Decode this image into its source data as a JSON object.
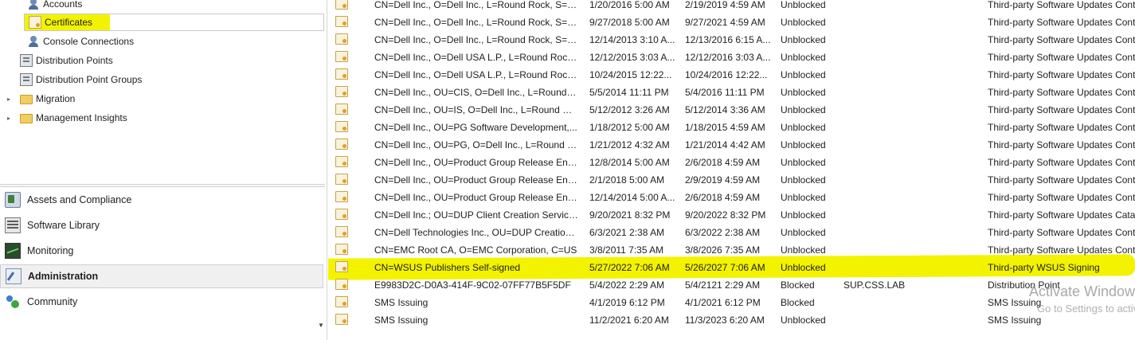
{
  "nav": {
    "tree": [
      {
        "label": "Accounts",
        "icon": "user-icon"
      },
      {
        "label": "Certificates",
        "icon": "certificate-icon"
      },
      {
        "label": "Console Connections",
        "icon": "user-icon"
      },
      {
        "label": "Distribution Points",
        "icon": "distribution-point-icon"
      },
      {
        "label": "Distribution Point Groups",
        "icon": "distribution-point-icon"
      },
      {
        "label": "Migration",
        "icon": "folder-icon"
      },
      {
        "label": "Management Insights",
        "icon": "folder-icon"
      }
    ],
    "workspaces": [
      {
        "label": "Assets and Compliance",
        "icon": "assets-icon"
      },
      {
        "label": "Software Library",
        "icon": "library-icon"
      },
      {
        "label": "Monitoring",
        "icon": "monitor-icon"
      },
      {
        "label": "Administration",
        "icon": "admin-icon"
      },
      {
        "label": "Community",
        "icon": "community-icon"
      }
    ]
  },
  "certificates": [
    {
      "subject": "CN=Dell Inc., O=Dell Inc., L=Round Rock, S=Te...",
      "valid_from": "1/20/2016 5:00 AM",
      "expires": "2/19/2019 4:59 AM",
      "status": "Unblocked",
      "site": "",
      "type": "Third-party Software Updates Cont"
    },
    {
      "subject": "CN=Dell Inc., O=Dell Inc., L=Round Rock, S=Te...",
      "valid_from": "9/27/2018 5:00 AM",
      "expires": "9/27/2021 4:59 AM",
      "status": "Unblocked",
      "site": "",
      "type": "Third-party Software Updates Cont"
    },
    {
      "subject": "CN=Dell Inc., O=Dell Inc., L=Round Rock, S=Te...",
      "valid_from": "12/14/2013 3:10 A...",
      "expires": "12/13/2016 6:15 A...",
      "status": "Unblocked",
      "site": "",
      "type": "Third-party Software Updates Cont"
    },
    {
      "subject": "CN=Dell Inc., O=Dell USA L.P., L=Round Rock,...",
      "valid_from": "12/12/2015 3:03 A...",
      "expires": "12/12/2016 3:03 A...",
      "status": "Unblocked",
      "site": "",
      "type": "Third-party Software Updates Cont"
    },
    {
      "subject": "CN=Dell Inc., O=Dell USA L.P., L=Round Rock,...",
      "valid_from": "10/24/2015 12:22...",
      "expires": "10/24/2016 12:22...",
      "status": "Unblocked",
      "site": "",
      "type": "Third-party Software Updates Cont"
    },
    {
      "subject": "CN=Dell Inc., OU=CIS, O=Dell Inc., L=Round R...",
      "valid_from": "5/5/2014 11:11 PM",
      "expires": "5/4/2016 11:11 PM",
      "status": "Unblocked",
      "site": "",
      "type": "Third-party Software Updates Cont"
    },
    {
      "subject": "CN=Dell Inc., OU=IS, O=Dell Inc., L=Round Ro...",
      "valid_from": "5/12/2012 3:26 AM",
      "expires": "5/12/2014 3:36 AM",
      "status": "Unblocked",
      "site": "",
      "type": "Third-party Software Updates Cont"
    },
    {
      "subject": "CN=Dell Inc., OU=PG Software Development,...",
      "valid_from": "1/18/2012 5:00 AM",
      "expires": "1/18/2015 4:59 AM",
      "status": "Unblocked",
      "site": "",
      "type": "Third-party Software Updates Cont"
    },
    {
      "subject": "CN=Dell Inc., OU=PG, O=Dell Inc., L=Round R...",
      "valid_from": "1/21/2012 4:32 AM",
      "expires": "1/21/2014 4:42 AM",
      "status": "Unblocked",
      "site": "",
      "type": "Third-party Software Updates Cont"
    },
    {
      "subject": "CN=Dell Inc., OU=Product Group Release Engi...",
      "valid_from": "12/8/2014 5:00 AM",
      "expires": "2/6/2018 4:59 AM",
      "status": "Unblocked",
      "site": "",
      "type": "Third-party Software Updates Cont"
    },
    {
      "subject": "CN=Dell Inc., OU=Product Group Release Engi...",
      "valid_from": "2/1/2018 5:00 AM",
      "expires": "2/9/2019 4:59 AM",
      "status": "Unblocked",
      "site": "",
      "type": "Third-party Software Updates Cont"
    },
    {
      "subject": "CN=Dell Inc., OU=Product Group Release Engi...",
      "valid_from": "12/14/2014 5:00 A...",
      "expires": "2/6/2018 4:59 AM",
      "status": "Unblocked",
      "site": "",
      "type": "Third-party Software Updates Cont"
    },
    {
      "subject": "CN=Dell Inc.; OU=DUP Client Creation Service;...",
      "valid_from": "9/20/2021 8:32 PM",
      "expires": "9/20/2022 8:32 PM",
      "status": "Unblocked",
      "site": "",
      "type": "Third-party Software Updates Catal"
    },
    {
      "subject": "CN=Dell Technologies Inc., OU=DUP Creation...",
      "valid_from": "6/3/2021 2:38 AM",
      "expires": "6/3/2022 2:38 AM",
      "status": "Unblocked",
      "site": "",
      "type": "Third-party Software Updates Cont"
    },
    {
      "subject": "CN=EMC Root CA, O=EMC Corporation, C=US",
      "valid_from": "3/8/2011 7:35 AM",
      "expires": "3/8/2026 7:35 AM",
      "status": "Unblocked",
      "site": "",
      "type": "Third-party Software Updates Cont"
    },
    {
      "subject": "CN=WSUS Publishers Self-signed",
      "valid_from": "5/27/2022 7:06 AM",
      "expires": "5/26/2027 7:06 AM",
      "status": "Unblocked",
      "site": "",
      "type": "Third-party WSUS Signing"
    },
    {
      "subject": "E9983D2C-D0A3-414F-9C02-07FF77B5F5DF",
      "valid_from": "5/4/2022 2:29 AM",
      "expires": "5/4/2121 2:29 AM",
      "status": "Blocked",
      "site": "SUP.CSS.LAB",
      "type": "Distribution Point"
    },
    {
      "subject": "SMS Issuing",
      "valid_from": "4/1/2019 6:12 PM",
      "expires": "4/1/2021 6:12 PM",
      "status": "Blocked",
      "site": "",
      "type": "SMS Issuing"
    },
    {
      "subject": "SMS Issuing",
      "valid_from": "11/2/2021 6:20 AM",
      "expires": "11/3/2023 6:20 AM",
      "status": "Unblocked",
      "site": "",
      "type": "SMS Issuing"
    }
  ],
  "watermark": {
    "line1": "Activate Windows",
    "line2": "Go to Settings to activate Windows."
  },
  "colors": {
    "highlight": "#f3f300",
    "selected_bg": "#f0f0f0"
  }
}
